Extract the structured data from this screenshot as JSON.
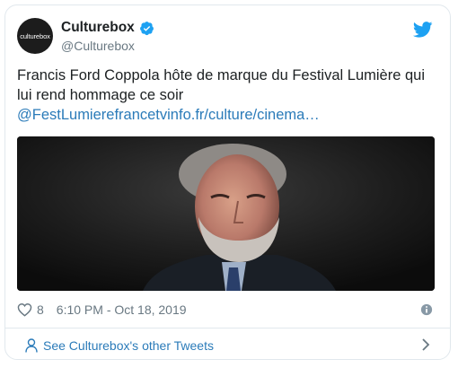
{
  "tweet": {
    "avatar_text": "culturebox",
    "name": "Culturebox",
    "handle": "@Culturebox",
    "text": "Francis Ford Coppola hôte de marque du Festival Lumière qui lui rend hommage ce soir",
    "link": "@FestLumierefrancetvinfo.fr/culture/cinema…",
    "likes": "8",
    "timestamp": "6:10 PM - Oct 18, 2019"
  },
  "footer": {
    "other_tweets": "See Culturebox's other Tweets"
  },
  "colors": {
    "twitter_blue": "#1da1f2",
    "link": "#2b7bb9",
    "muted": "#697882",
    "border": "#e1e8ed"
  },
  "icons": [
    "verified-badge-icon",
    "twitter-bird-icon",
    "heart-icon",
    "info-icon",
    "person-icon",
    "chevron-right-icon"
  ]
}
